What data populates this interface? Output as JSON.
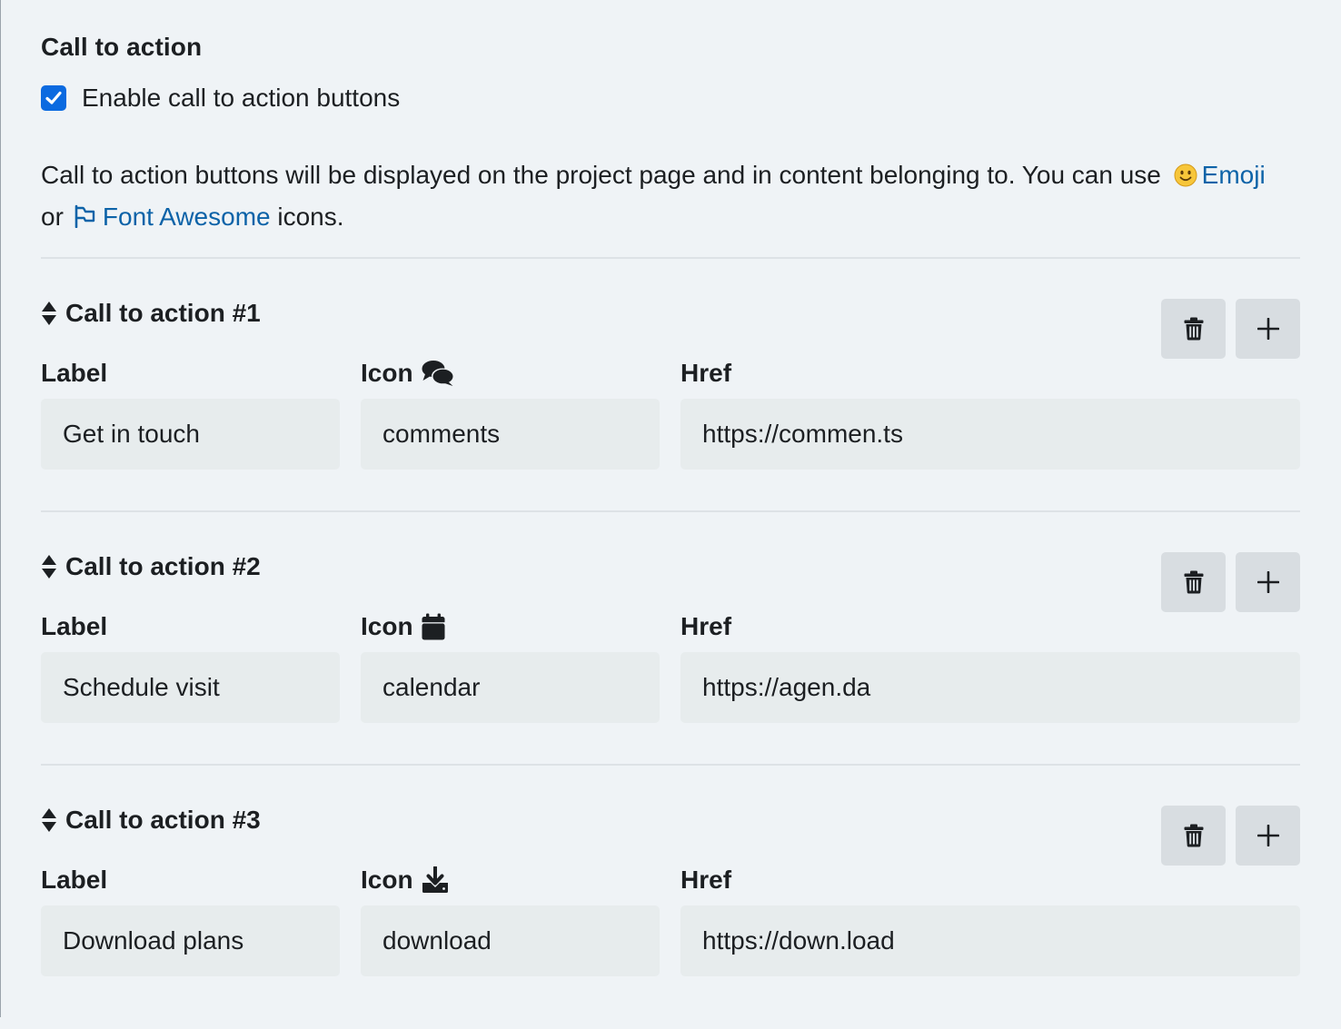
{
  "section": {
    "title": "Call to action",
    "enable_label": "Enable call to action buttons",
    "enable_checked": true,
    "description_before": "Call to action buttons will be displayed on the project page and in content belonging to. You can use",
    "emoji_link": "Emoji",
    "description_or": "or",
    "font_awesome_link": "Font Awesome",
    "description_after": "icons."
  },
  "field_labels": {
    "label": "Label",
    "icon": "Icon",
    "href": "Href"
  },
  "ctas": [
    {
      "title": "Call to action #1",
      "label_value": "Get in touch",
      "icon_value": "comments",
      "icon_name": "comments-icon",
      "href_value": "https://commen.ts"
    },
    {
      "title": "Call to action #2",
      "label_value": "Schedule visit",
      "icon_value": "calendar",
      "icon_name": "calendar-icon",
      "href_value": "https://agen.da"
    },
    {
      "title": "Call to action #3",
      "label_value": "Download plans",
      "icon_value": "download",
      "icon_name": "download-icon",
      "href_value": "https://down.load"
    }
  ],
  "colors": {
    "background": "#eff3f6",
    "accent": "#0b6ae0",
    "link": "#0d63a8",
    "input_bg": "#e7eced",
    "button_bg": "#d8dde1"
  }
}
